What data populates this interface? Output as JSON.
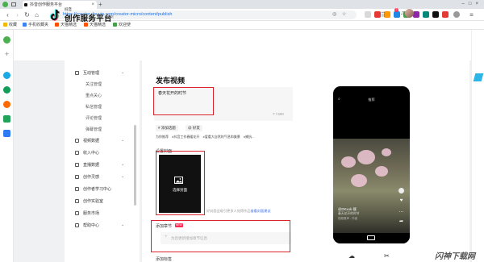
{
  "browser": {
    "tab_title": "抖音创作服务平台",
    "url": "https://creator.douyin.com/creator-micro/content/publish",
    "bookmarks": [
      "收藏",
      "手机收藏夹",
      "天猫精选",
      "天猫精选",
      "欢迎使"
    ]
  },
  "header": {
    "logo_small": "抖音",
    "logo_title": "创作服务平台",
    "logo_tag": "PC端",
    "notification_count": "2"
  },
  "sidebar": {
    "items": [
      {
        "label": "互动管理",
        "level": 1,
        "expandable": true
      },
      {
        "label": "关注管理",
        "level": 2
      },
      {
        "label": "重点关心",
        "level": 2
      },
      {
        "label": "私信管理",
        "level": 2
      },
      {
        "label": "评论管理",
        "level": 2
      },
      {
        "label": "弹幕管理",
        "level": 2
      },
      {
        "label": "视频数据",
        "level": 1,
        "expandable": true
      },
      {
        "label": "收入中心",
        "level": 1,
        "expandable": false
      },
      {
        "label": "直播数据",
        "level": 1,
        "expandable": true
      },
      {
        "label": "创作灵感",
        "level": 1,
        "expandable": true
      },
      {
        "label": "创作者学习中心",
        "level": 1,
        "expandable": false
      },
      {
        "label": "创作实验室",
        "level": 1,
        "expandable": false
      },
      {
        "label": "服务市场",
        "level": 1,
        "expandable": false
      },
      {
        "label": "帮助中心",
        "level": 1,
        "expandable": true
      }
    ]
  },
  "publish": {
    "title": "发布视频",
    "description": "春天花开的时节",
    "char_count": "7 / 500",
    "chip_topic": "# 添加话题",
    "chip_friend": "@ 好友",
    "rec_label": "为你推荐",
    "rec_tags": [
      "#抖音工作春暖花开",
      "#爱看大自然的气息和美景",
      "#捕抗..."
    ],
    "cover_label": "设置封面",
    "cover_button": "选择封面",
    "cover_hint": "好封面会吸引更多人觉得作品",
    "cover_link": "查看封面建议",
    "chapter_label": "添加章节",
    "chapter_new": "NEW",
    "chapter_placeholder": "为您更新增加章节信息",
    "tags_label": "添加标签"
  },
  "phone": {
    "top_bar": "推荐 ",
    "author": "@DKxuk·搜",
    "caption": "春天花开的时节",
    "sub": "视频原声 - 作者"
  },
  "watermark": "闪神下载网"
}
